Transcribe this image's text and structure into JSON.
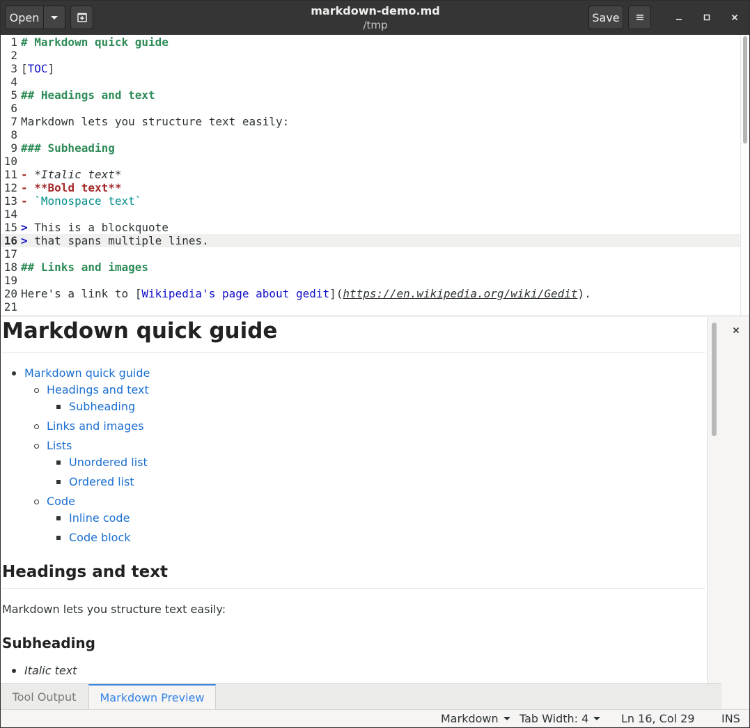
{
  "header": {
    "open_label": "Open",
    "title": "markdown-demo.md",
    "subtitle": "/tmp",
    "save_label": "Save"
  },
  "editor": {
    "current_line": 16,
    "lines": [
      {
        "n": "1"
      },
      {
        "n": "2"
      },
      {
        "n": "3"
      },
      {
        "n": "4"
      },
      {
        "n": "5"
      },
      {
        "n": "6"
      },
      {
        "n": "7"
      },
      {
        "n": "8"
      },
      {
        "n": "9"
      },
      {
        "n": "10"
      },
      {
        "n": "11"
      },
      {
        "n": "12"
      },
      {
        "n": "13"
      },
      {
        "n": "14"
      },
      {
        "n": "15"
      },
      {
        "n": "16"
      },
      {
        "n": "17"
      },
      {
        "n": "18"
      },
      {
        "n": "19"
      },
      {
        "n": "20"
      },
      {
        "n": "21"
      }
    ],
    "l1": "# Markdown quick guide",
    "l3_open": "[",
    "l3_toc": "TOC",
    "l3_close": "]",
    "l5": "## Headings and text",
    "l7": "Markdown lets you structure text easily:",
    "l9": "### Subheading",
    "l11_dash": "-",
    "l11_text": " *Italic text*",
    "l12_dash": "-",
    "l12_text": " **Bold text**",
    "l13_dash": "-",
    "l13_text": " `Monospace text`",
    "l15_gt": ">",
    "l15_text": " This is a blockquote",
    "l16_gt": ">",
    "l16_text": " that spans multiple lines.",
    "l18": "## Links and images",
    "l20_pre": "Here's a link to [",
    "l20_link": "Wikipedia's page about gedit",
    "l20_mid": "](",
    "l20_url": "https://en.wikipedia.org/wiki/Gedit",
    "l20_end": ")."
  },
  "preview": {
    "h1": "Markdown quick guide",
    "toc": {
      "t1": "Markdown quick guide",
      "t2": "Headings and text",
      "t3": "Subheading",
      "t4": "Links and images",
      "t5": "Lists",
      "t6": "Unordered list",
      "t7": "Ordered list",
      "t8": "Code",
      "t9": "Inline code",
      "t10": "Code block"
    },
    "h2": "Headings and text",
    "paragraph": "Markdown lets you structure text easily:",
    "h3": "Subheading",
    "item_italic": "Italic text"
  },
  "tabs": {
    "tool_output": "Tool Output",
    "markdown_preview": "Markdown Preview"
  },
  "status": {
    "language": "Markdown",
    "tab_width": "Tab Width: 4",
    "position": "Ln 16, Col 29",
    "mode": "INS"
  }
}
